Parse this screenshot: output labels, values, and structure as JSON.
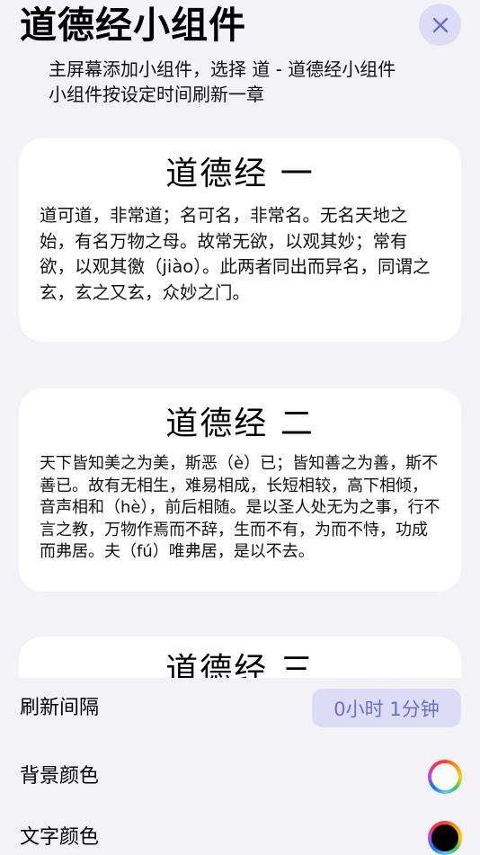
{
  "header": {
    "title": "道德经小组件",
    "close_icon": "close-icon",
    "subtitle_line1": "主屏幕添加小组件，选择 道 - 道德经小组件",
    "subtitle_line2": "小组件按设定时间刷新一章"
  },
  "chapters": [
    {
      "title": "道德经 一",
      "text": "道可道，非常道；名可名，非常名。无名天地之始，有名万物之母。故常无欲，以观其妙；常有欲，以观其徼（jiào）。此两者同出而异名，同谓之玄，玄之又玄，众妙之门。"
    },
    {
      "title": "道德经 二",
      "text": "天下皆知美之为美，斯恶（è）已；皆知善之为善，斯不善已。故有无相生，难易相成，长短相较，高下相倾，音声相和（hè），前后相随。是以圣人处无为之事，行不言之教，万物作焉而不辞，生而不有，为而不恃，功成而弗居。夫（fú）唯弗居，是以不去。"
    },
    {
      "title": "道德经 三",
      "text": ""
    }
  ],
  "settings": {
    "interval_label": "刷新间隔",
    "interval_value": "0小时 1分钟",
    "bg_color_label": "背景颜色",
    "bg_color_value": "#ffffff",
    "text_color_label": "文字颜色",
    "text_color_value": "#000000"
  },
  "colors": {
    "accent": "#6b6bd0",
    "accent_bg": "#dcdcf7",
    "page_bg": "#f2f2f7",
    "card_bg": "#ffffff"
  }
}
